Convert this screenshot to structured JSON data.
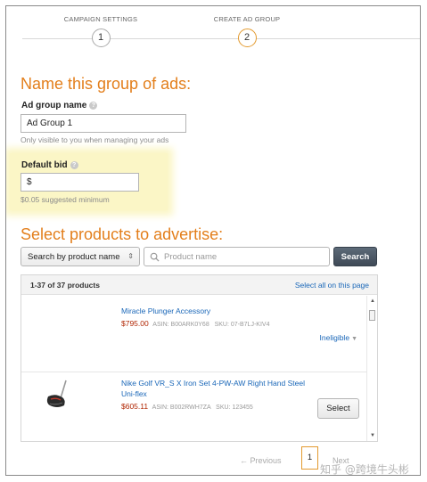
{
  "stepper": {
    "steps": [
      {
        "label": "CAMPAIGN SETTINGS",
        "number": "1"
      },
      {
        "label": "CREATE AD GROUP",
        "number": "2"
      }
    ]
  },
  "name_section": {
    "heading": "Name this group of ads:",
    "ad_group_name_label": "Ad group name",
    "ad_group_name_value": "Ad Group 1",
    "ad_group_name_hint": "Only visible to you when managing your ads"
  },
  "bid_section": {
    "label": "Default bid",
    "value": "$",
    "hint": "$0.05 suggested minimum",
    "highlight_color": "#fbf6c6"
  },
  "products_section": {
    "heading": "Select products to advertise:",
    "search_by": "Search by product name",
    "search_placeholder": "Product name",
    "search_button": "Search",
    "results_count": "1-37 of 37 products",
    "select_all": "Select all on this page",
    "products": [
      {
        "title": "Miracle Plunger Accessory",
        "price": "$795.00",
        "asin": "ASIN: B00ARK0Y68",
        "sku": "SKU: 07-B7LJ-KIV4",
        "action": "Ineligible"
      },
      {
        "title": "Nike Golf VR_S X Iron Set 4-PW-AW Right Hand Steel Uni-flex",
        "price": "$605.11",
        "asin": "ASIN: B002RWH7ZA",
        "sku": "SKU: 123455",
        "action": "Select"
      }
    ]
  },
  "pagination": {
    "previous": "← Previous",
    "current_page": "1",
    "next": "Next"
  },
  "watermark": "知乎 @跨境牛头彬",
  "colors": {
    "accent_orange": "#e37f1c",
    "link_blue": "#1a67b8",
    "price_red": "#b12704"
  }
}
